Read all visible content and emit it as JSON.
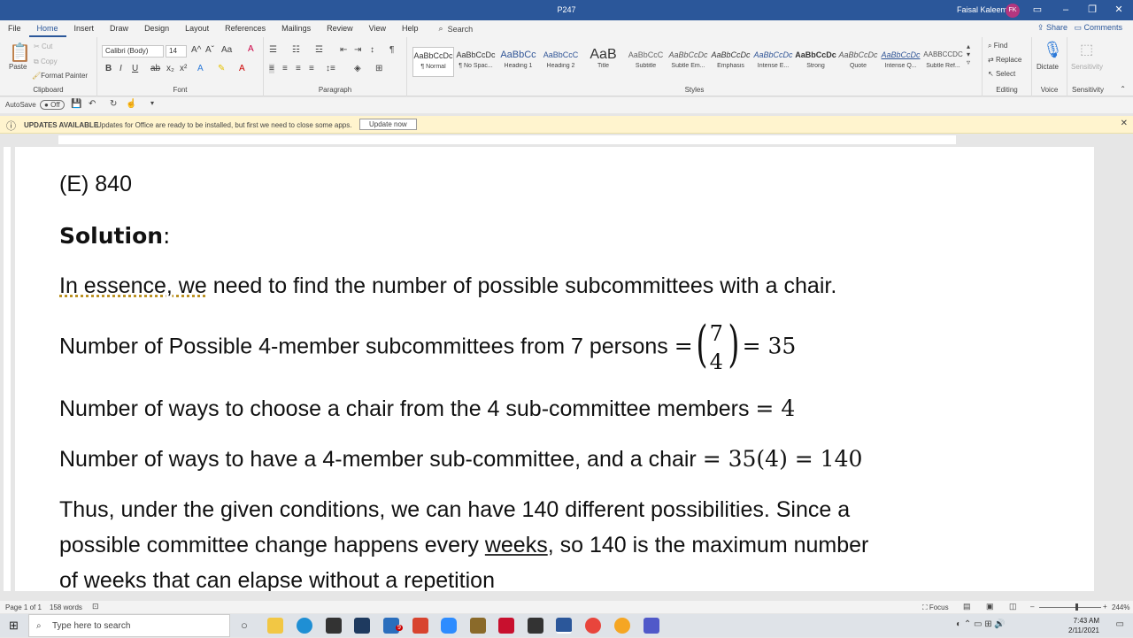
{
  "titlebar": {
    "doc_title": "P247",
    "user": "Faisal Kaleem",
    "initials": "FK"
  },
  "tabs": [
    "File",
    "Home",
    "Insert",
    "Draw",
    "Design",
    "Layout",
    "References",
    "Mailings",
    "Review",
    "View",
    "Help"
  ],
  "search": {
    "label": "Search"
  },
  "share": "Share",
  "comments": "Comments",
  "clipboard": {
    "paste": "Paste",
    "cut": "Cut",
    "copy": "Copy",
    "painter": "Format Painter",
    "label": "Clipboard"
  },
  "font": {
    "name": "Calibri (Body)",
    "size": "14",
    "label": "Font"
  },
  "paragraph": {
    "label": "Paragraph"
  },
  "styles": {
    "label": "Styles",
    "items": [
      {
        "preview": "AaBbCcDc",
        "name": "¶ Normal"
      },
      {
        "preview": "AaBbCcDc",
        "name": "¶ No Spac..."
      },
      {
        "preview": "AaBbCc",
        "name": "Heading 1"
      },
      {
        "preview": "AaBbCcC",
        "name": "Heading 2"
      },
      {
        "preview": "AaB",
        "name": "Title"
      },
      {
        "preview": "AaBbCcC",
        "name": "Subtitle"
      },
      {
        "preview": "AaBbCcDc",
        "name": "Subtle Em..."
      },
      {
        "preview": "AaBbCcDc",
        "name": "Emphasis"
      },
      {
        "preview": "AaBbCcDc",
        "name": "Intense E..."
      },
      {
        "preview": "AaBbCcDc",
        "name": "Strong"
      },
      {
        "preview": "AaBbCcDc",
        "name": "Quote"
      },
      {
        "preview": "AaBbCcDc",
        "name": "Intense Q..."
      },
      {
        "preview": "AABBCCDC",
        "name": "Subtle Ref..."
      }
    ]
  },
  "editing": {
    "find": "Find",
    "replace": "Replace",
    "select": "Select",
    "label": "Editing"
  },
  "voice": {
    "dictate": "Dictate",
    "label": "Voice"
  },
  "sensitivity": {
    "btn": "Sensitivity",
    "label": "Sensitivity"
  },
  "qat": {
    "autosave": "AutoSave",
    "toggle": "Off"
  },
  "update": {
    "title": "UPDATES AVAILABLE",
    "message": "Updates for Office are ready to be installed, but first we need to close some apps.",
    "button": "Update now"
  },
  "doc": {
    "choice_e": "(E) 840",
    "solution": "Solution",
    "colon": ":",
    "essence_a": "In essence, we",
    "essence_b": " need to find the number of possible subcommittees with a chair.",
    "line1_text": "Number of Possible 4-member subcommittees from 7 persons ",
    "eq": "=",
    "binom_n": "7",
    "binom_k": "4",
    "line1_result": "= 35",
    "line2_text": "Number of ways to choose a chair from the 4 sub-committee members ",
    "line2_math": "= 4",
    "line3_text": "Number of ways to have a 4-member sub-committee, and a chair ",
    "line3_math": "= 35(4) = 140",
    "para1": "Thus, under the given conditions, we can have 140 different possibilities.  Since a",
    "para2a": "possible committee change happens every ",
    "para2b": "weeks",
    "para2c": ", so 140 is the maximum number",
    "para3": "of weeks that can elapse without a repetition"
  },
  "status": {
    "page": "Page 1 of 1",
    "words": "158 words",
    "focus": "Focus",
    "zoom": "244%"
  },
  "taskbar": {
    "search": "Type here to search",
    "time": "7:43 AM",
    "date": "2/11/2021",
    "mail_badge": "9"
  },
  "colors": {
    "word_blue": "#2b579a",
    "update_bg": "#fff4ce"
  }
}
